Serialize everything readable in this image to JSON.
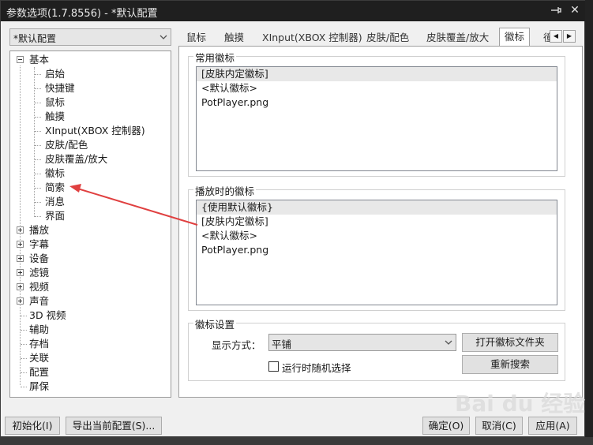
{
  "window": {
    "title": "参数选项(1.7.8556) - *默认配置"
  },
  "profile": {
    "selected": "*默认配置"
  },
  "tree": {
    "items": [
      {
        "label": "基本",
        "expander": "minus"
      },
      {
        "label": "启始"
      },
      {
        "label": "快捷键"
      },
      {
        "label": "鼠标"
      },
      {
        "label": "触摸"
      },
      {
        "label": "XInput(XBOX 控制器)"
      },
      {
        "label": "皮肤/配色"
      },
      {
        "label": "皮肤覆盖/放大"
      },
      {
        "label": "徽标"
      },
      {
        "label": "简索"
      },
      {
        "label": "消息"
      },
      {
        "label": "界面"
      },
      {
        "label": "播放",
        "expander": "plus"
      },
      {
        "label": "字幕",
        "expander": "plus"
      },
      {
        "label": "设备",
        "expander": "plus"
      },
      {
        "label": "滤镜",
        "expander": "plus"
      },
      {
        "label": "视频",
        "expander": "plus"
      },
      {
        "label": "声音",
        "expander": "plus"
      },
      {
        "label": "3D 视频"
      },
      {
        "label": "辅助"
      },
      {
        "label": "存档"
      },
      {
        "label": "关联"
      },
      {
        "label": "配置"
      },
      {
        "label": "屏保"
      }
    ]
  },
  "tabs": [
    {
      "label": "鼠标"
    },
    {
      "label": "触摸"
    },
    {
      "label": "XInput(XBOX 控制器)"
    },
    {
      "label": "皮肤/配色"
    },
    {
      "label": "皮肤覆盖/放大"
    },
    {
      "label": "徽标",
      "active": true
    },
    {
      "label": "徸"
    }
  ],
  "common_logo": {
    "group_label": "常用徽标",
    "items": [
      "[皮肤内定徽标]",
      "<默认徽标>",
      "PotPlayer.png"
    ]
  },
  "playback_logo": {
    "group_label": "播放时的徽标",
    "items": [
      "{使用默认徽标}",
      "[皮肤内定徽标]",
      "<默认徽标>",
      "PotPlayer.png"
    ]
  },
  "logo_settings": {
    "group_label": "徽标设置",
    "display_mode_label": "显示方式：",
    "display_mode_value": "平铺",
    "open_folder_button": "打开徽标文件夹",
    "random_checkbox_label": "运行时随机选择",
    "random_checked": false,
    "research_button": "重新搜索"
  },
  "footer": {
    "init_button": "初始化(I)",
    "export_button": "导出当前配置(S)...",
    "ok_button": "确定(O)",
    "cancel_button": "取消(C)",
    "apply_button": "应用(A)"
  },
  "watermark": "Bai du 经验",
  "colors": {
    "annotation_arrow": "#e04040",
    "titlebar_bg": "#1f1f1f",
    "selection_bg": "#e8e8e8"
  }
}
